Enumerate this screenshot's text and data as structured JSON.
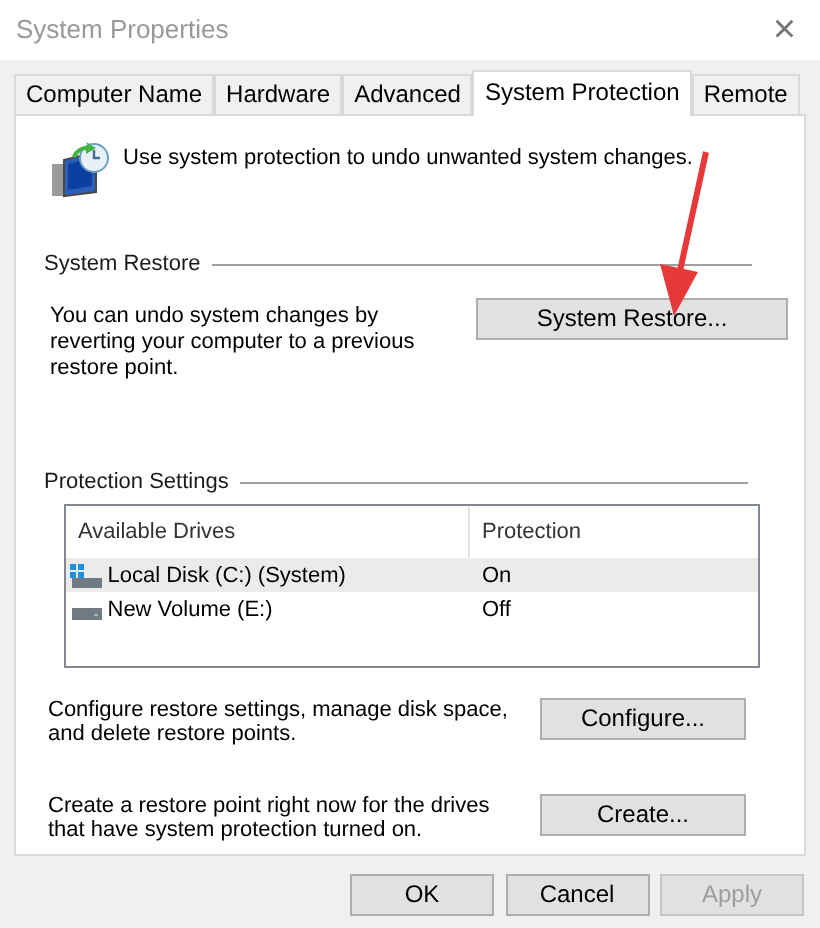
{
  "window": {
    "title": "System Properties",
    "close": "×"
  },
  "tabs": [
    {
      "label": "Computer Name",
      "selected": false
    },
    {
      "label": "Hardware",
      "selected": false
    },
    {
      "label": "Advanced",
      "selected": false
    },
    {
      "label": "System Protection",
      "selected": true
    },
    {
      "label": "Remote",
      "selected": false
    }
  ],
  "intro": "Use system protection to undo unwanted system changes.",
  "system_restore": {
    "heading": "System Restore",
    "text": "You can undo system changes by reverting your computer to a previous restore point.",
    "button": "System Restore..."
  },
  "protection_settings": {
    "heading": "Protection Settings",
    "columns": [
      "Available Drives",
      "Protection"
    ],
    "rows": [
      {
        "drive": "Local Disk (C:) (System)",
        "protection": "On",
        "kind": "system",
        "selected": true
      },
      {
        "drive": "New Volume (E:)",
        "protection": "Off",
        "kind": "volume",
        "selected": false
      }
    ],
    "actions": [
      {
        "text": "Configure restore settings, manage disk space, and delete restore points.",
        "button": "Configure..."
      },
      {
        "text": "Create a restore point right now for the drives that have system protection turned on.",
        "button": "Create..."
      }
    ]
  },
  "buttons": [
    {
      "label": "OK",
      "disabled": false
    },
    {
      "label": "Cancel",
      "disabled": false
    },
    {
      "label": "Apply",
      "disabled": true
    }
  ]
}
